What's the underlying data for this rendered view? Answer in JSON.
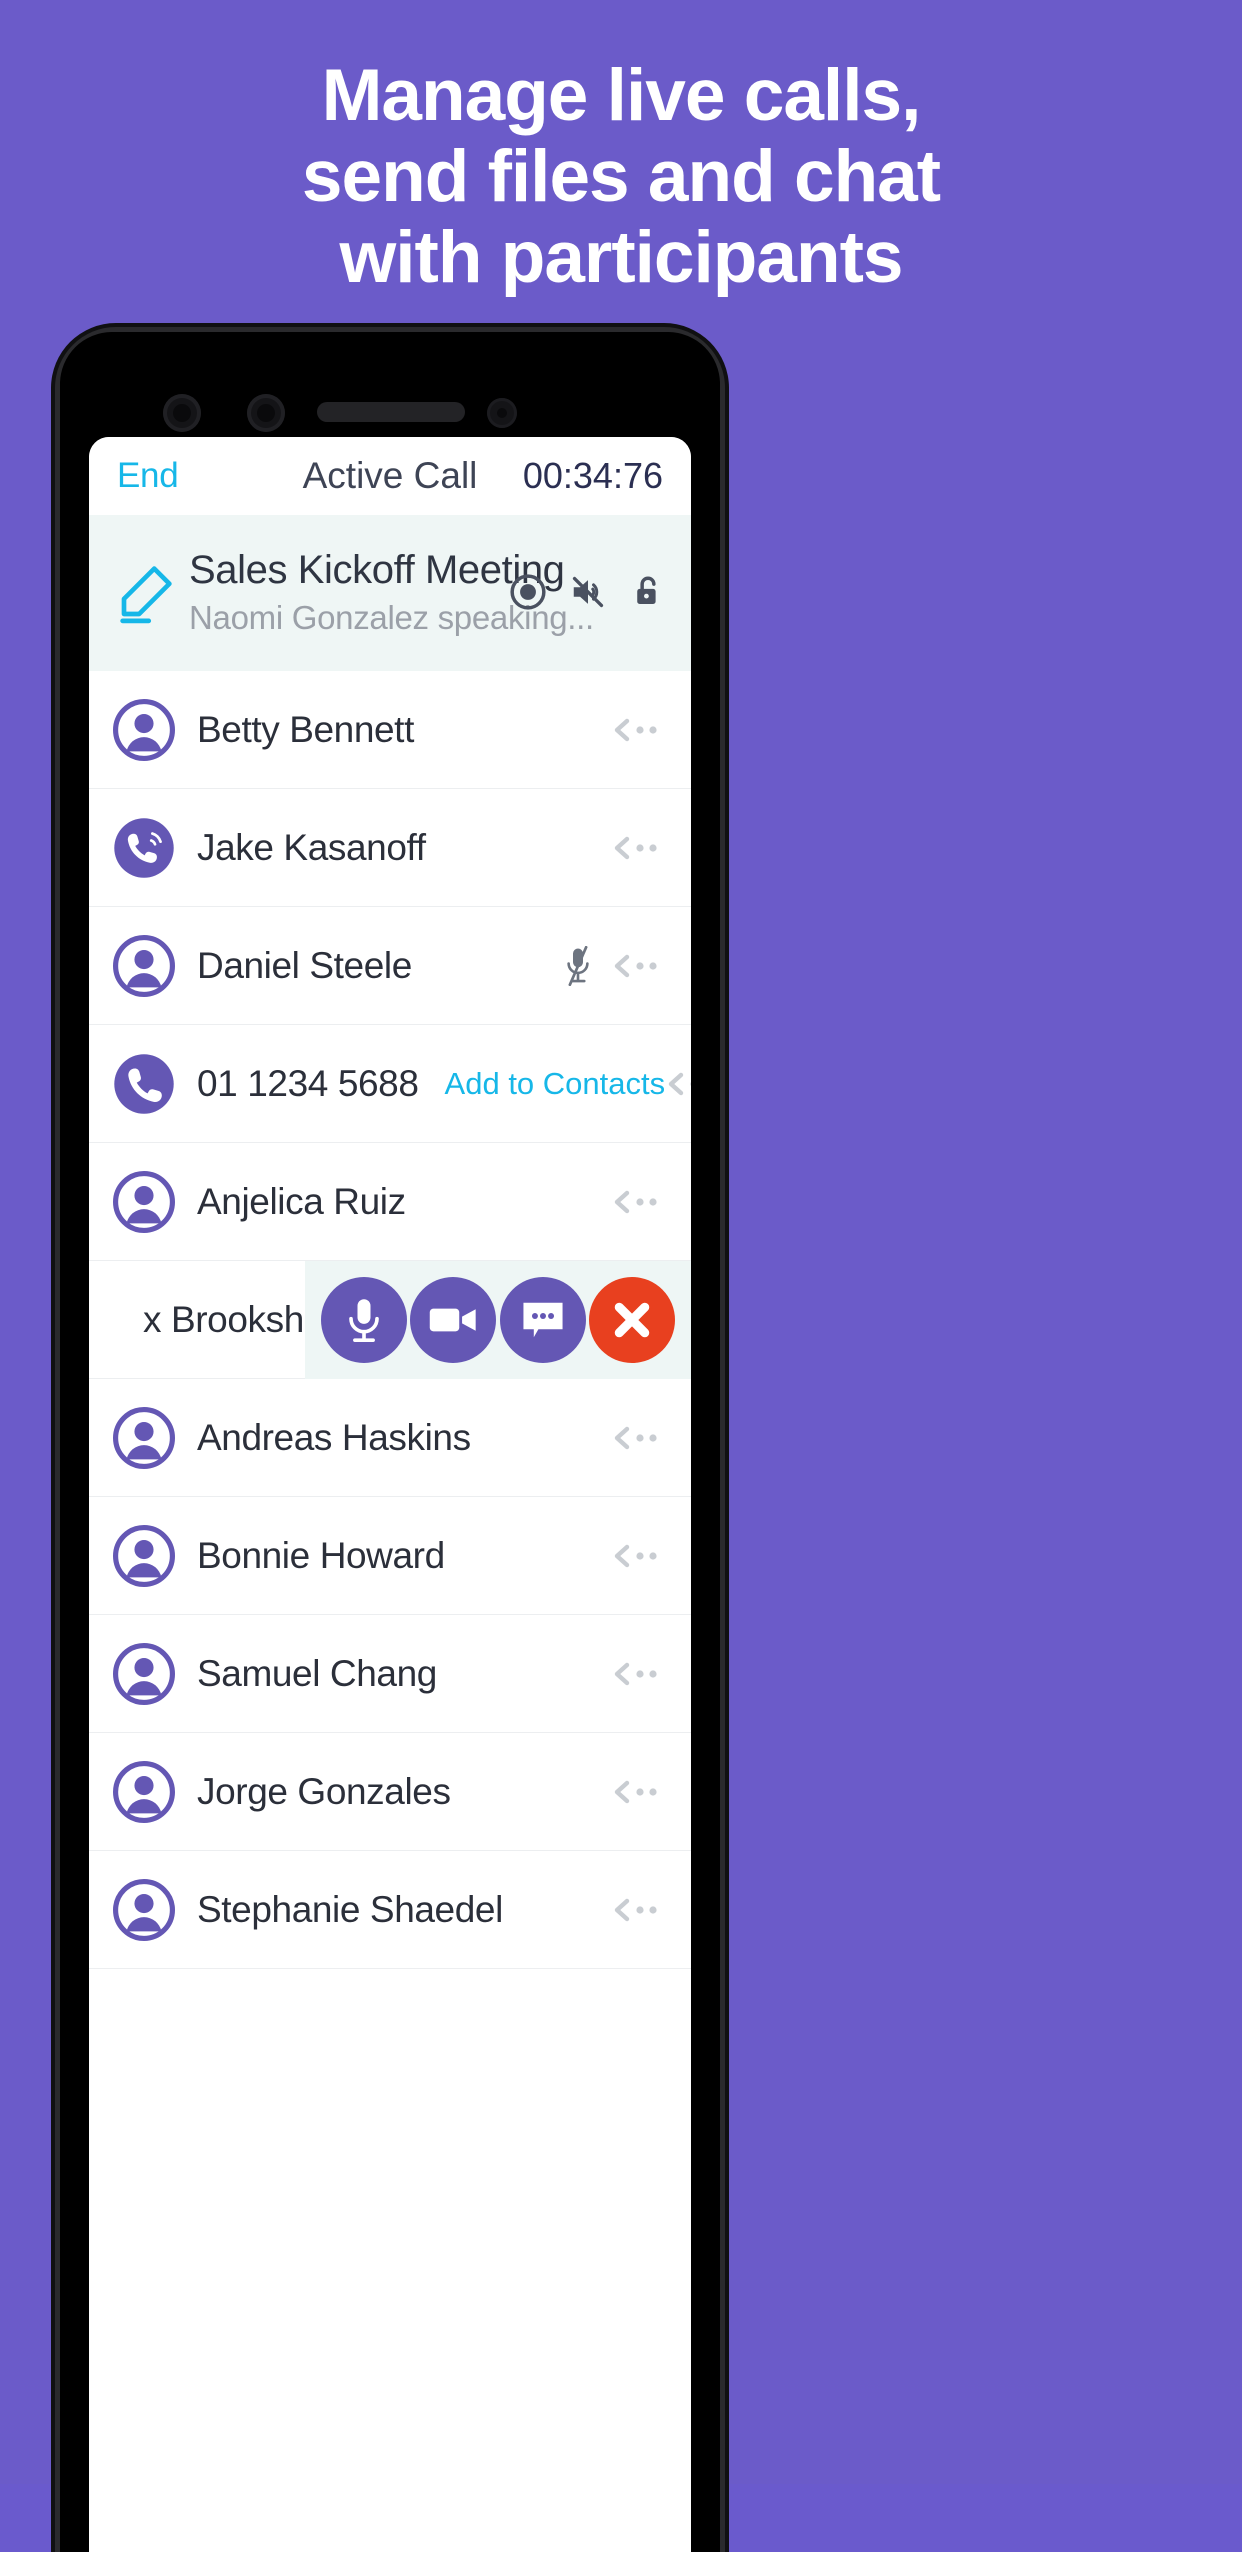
{
  "theme": {
    "background": "#6b5bc9",
    "accent_cyan": "#16b7e8",
    "avatar_purple": "#6457b4",
    "danger_red": "#e8401f",
    "card_bg": "#eff6f5",
    "text_dark": "#2b2f3a"
  },
  "headline": {
    "line1": "Manage live calls,",
    "line2": "send files and chat",
    "line3": "with participants"
  },
  "app": {
    "navbar": {
      "end_label": "End",
      "title": "Active Call",
      "timer": "00:34:76"
    },
    "meeting": {
      "edit_icon": "pencil-icon",
      "title": "Sales Kickoff Meeting",
      "subtitle": "Naomi Gonzalez speaking...",
      "icons": [
        {
          "name": "record-icon"
        },
        {
          "name": "speaker-mute-icon"
        },
        {
          "name": "unlocked-padlock-icon"
        }
      ]
    },
    "participants": [
      {
        "name": "Betty Bennett",
        "avatar": "person-avatar",
        "muted": false,
        "chevron": true
      },
      {
        "name": "Jake Kasanoff",
        "avatar": "phone-ring-avatar",
        "muted": false,
        "chevron": true
      },
      {
        "name": "Daniel Steele",
        "avatar": "person-avatar",
        "muted": true,
        "chevron": true
      },
      {
        "name": "01 1234 5688",
        "avatar": "phone-avatar",
        "muted": false,
        "chevron": true,
        "action_label": "Add to Contacts",
        "is_number": true
      },
      {
        "name": "Anjelica Ruiz",
        "avatar": "person-avatar",
        "muted": false,
        "chevron": true
      },
      {
        "name": "x Brookshire",
        "avatar": "person-avatar",
        "muted": false,
        "chevron": false,
        "clipped": true
      },
      {
        "name": "Andreas Haskins",
        "avatar": "person-avatar",
        "muted": false,
        "chevron": true
      },
      {
        "name": "Bonnie Howard",
        "avatar": "person-avatar",
        "muted": false,
        "chevron": true
      },
      {
        "name": "Samuel Chang",
        "avatar": "person-avatar",
        "muted": false,
        "chevron": true
      },
      {
        "name": "Jorge Gonzales",
        "avatar": "person-avatar",
        "muted": false,
        "chevron": true
      },
      {
        "name": "Stephanie Shaedel",
        "avatar": "person-avatar",
        "muted": false,
        "chevron": true
      }
    ],
    "action_bar": [
      {
        "name": "microphone-button",
        "icon": "microphone-icon"
      },
      {
        "name": "video-button",
        "icon": "video-camera-icon"
      },
      {
        "name": "chat-button",
        "icon": "chat-bubble-icon"
      },
      {
        "name": "end-call-button",
        "icon": "close-x-icon"
      }
    ]
  }
}
